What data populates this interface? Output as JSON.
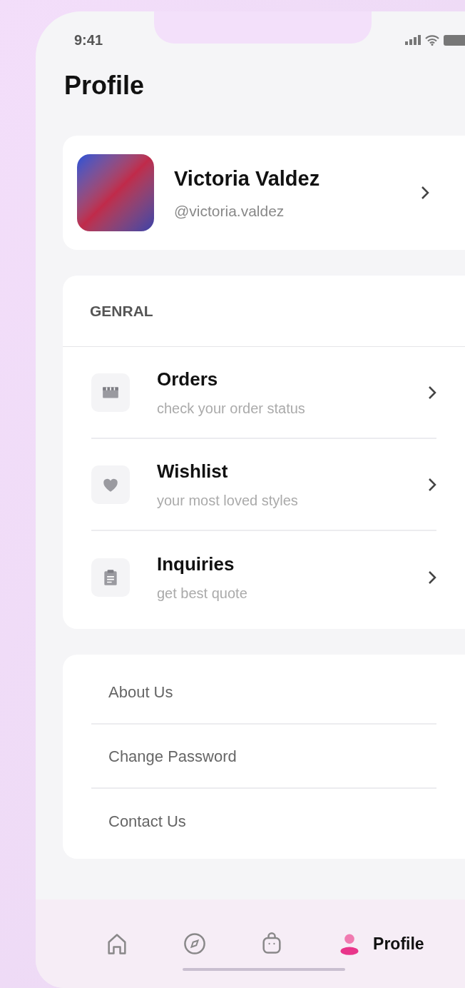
{
  "status_bar": {
    "time": "9:41"
  },
  "title": "Profile",
  "profile": {
    "name": "Victoria Valdez",
    "handle": "@victoria.valdez"
  },
  "general": {
    "heading": "GENRAL",
    "items": [
      {
        "kind": "store",
        "title": "Orders",
        "subtitle": "check your order status"
      },
      {
        "kind": "heart",
        "title": "Wishlist",
        "subtitle": "your most loved styles"
      },
      {
        "kind": "clipboard",
        "title": "Inquiries",
        "subtitle": "get best quote"
      }
    ]
  },
  "links": [
    "About Us",
    "Change Password",
    "Contact Us"
  ],
  "nav": [
    {
      "kind": "home",
      "selected": false
    },
    {
      "kind": "compass",
      "selected": false
    },
    {
      "kind": "bag",
      "selected": false
    },
    {
      "kind": "profile",
      "label": "Profile",
      "selected": true
    }
  ]
}
